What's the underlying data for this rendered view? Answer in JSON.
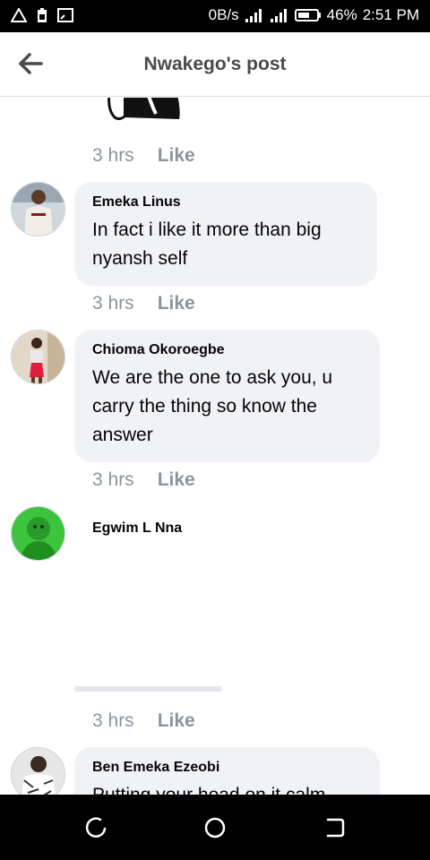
{
  "status_bar": {
    "left_icons": [
      "warning-triangle-icon",
      "battery-saver-icon",
      "screen-cast-icon"
    ],
    "speed": "0B/s",
    "battery": "46%",
    "time": "2:51 PM"
  },
  "header": {
    "title": "Nwakego's post"
  },
  "first_meta": {
    "time": "3 hrs",
    "like": "Like"
  },
  "comments": [
    {
      "name": "Emeka Linus",
      "text_lines": [
        "In fact i like it more than big",
        "nyansh self"
      ],
      "time": "3 hrs",
      "like": "Like"
    },
    {
      "name": "Chioma Okoroegbe",
      "text_lines": [
        "We are the one to ask you, u",
        "carry the thing so know the",
        "answer"
      ],
      "time": "3 hrs",
      "like": "Like"
    },
    {
      "name": "Egwim L Nna",
      "time": "3 hrs",
      "like": "Like"
    },
    {
      "name": "Ben Emeka Ezeobi",
      "text_lines": [
        "Putting your head on it calm"
      ]
    }
  ],
  "nav": {
    "icons": [
      "recent-apps-icon",
      "home-icon",
      "back-icon"
    ]
  }
}
